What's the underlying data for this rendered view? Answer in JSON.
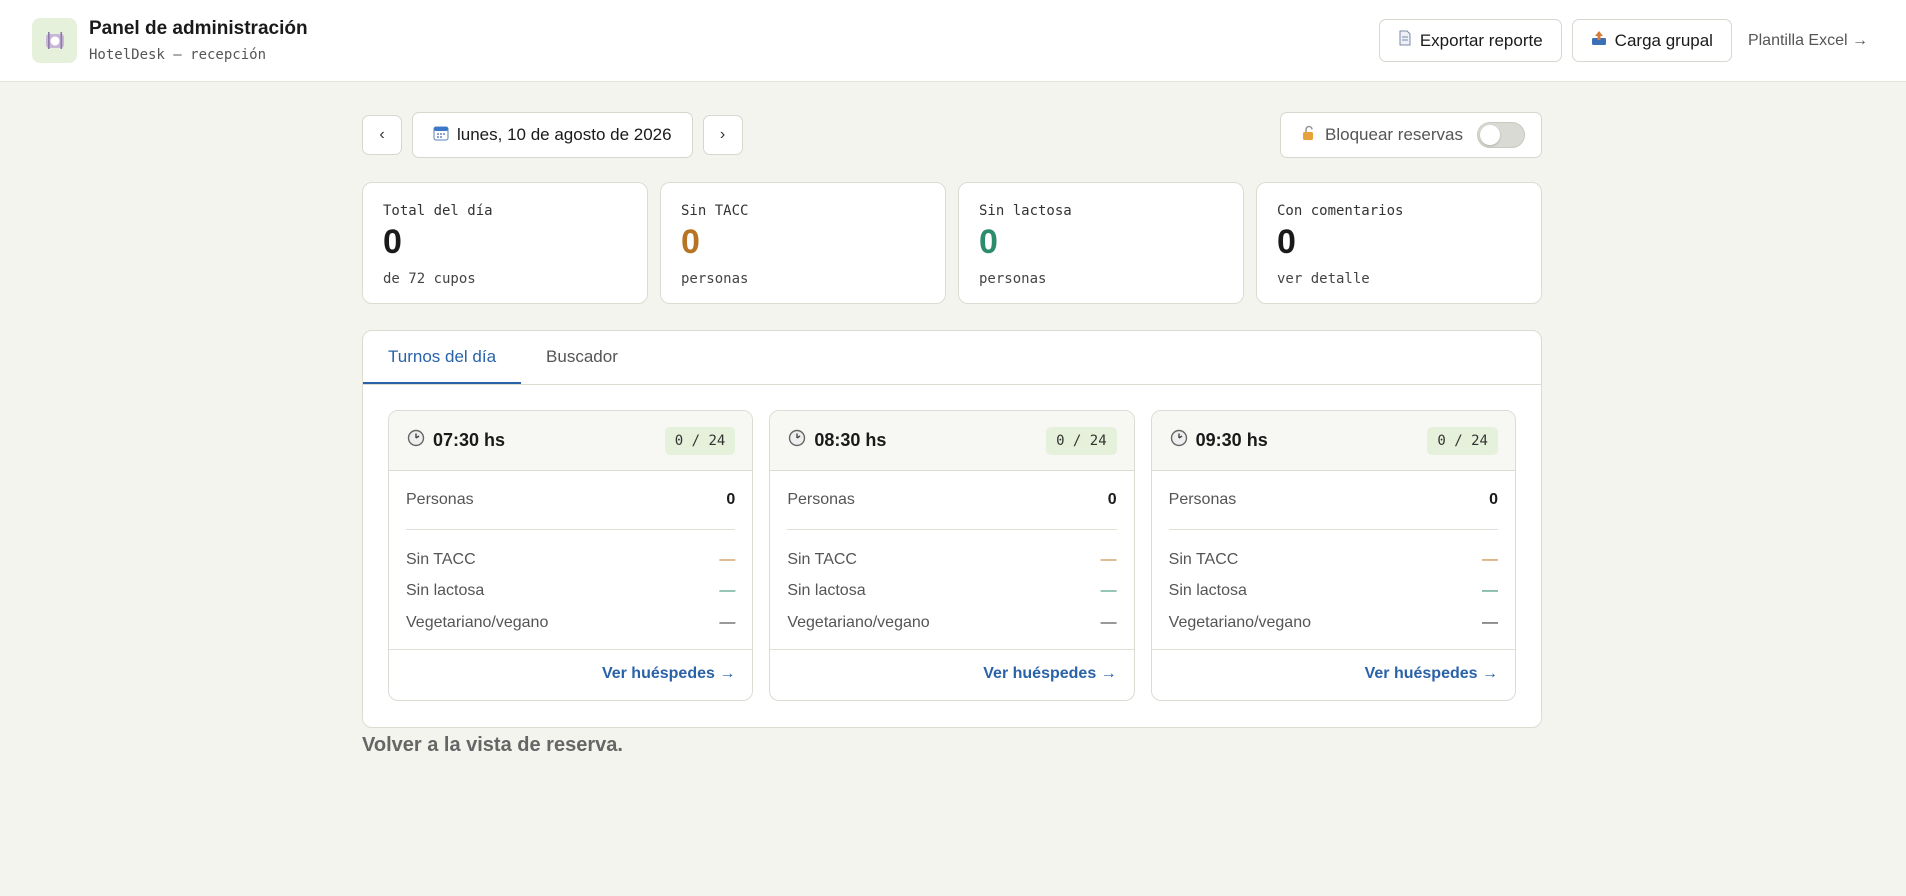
{
  "header": {
    "title": "Panel de administración",
    "subtitle": "HotelDesk — recepción",
    "logo_icon": "plate-cutlery-icon",
    "export_label": "Exportar reporte",
    "bulk_label": "Carga grupal",
    "template_link": "Plantilla Excel →"
  },
  "toolbar": {
    "prev": "‹",
    "next": "›",
    "date": "lunes, 10 de agosto de 2026",
    "lock_label": "Bloquear reservas",
    "lock_on": false
  },
  "stats": [
    {
      "label": "Total del día",
      "value": "0",
      "sub": "de 72 cupos",
      "color": "#1a1a1a"
    },
    {
      "label": "Sin TACC",
      "value": "0",
      "sub": "personas",
      "color": "#b87425"
    },
    {
      "label": "Sin lactosa",
      "value": "0",
      "sub": "personas",
      "color": "#2e8c6e"
    },
    {
      "label": "Con comentarios",
      "value": "0",
      "sub": "ver detalle",
      "color": "#1a1a1a"
    }
  ],
  "tabs": [
    {
      "label": "Turnos del día",
      "active": true
    },
    {
      "label": "Buscador",
      "active": false
    }
  ],
  "shifts": [
    {
      "time": "07:30 hs",
      "capacity": "0 / 24",
      "people_label": "Personas",
      "people": "0",
      "diets": [
        {
          "label": "Sin TACC",
          "value": "—",
          "color": "#c07b2c"
        },
        {
          "label": "Sin lactosa",
          "value": "—",
          "color": "#2e8c6e"
        },
        {
          "label": "Vegetariano/vegano",
          "value": "—",
          "color": "#333333"
        }
      ],
      "link": "Ver huéspedes →"
    },
    {
      "time": "08:30 hs",
      "capacity": "0 / 24",
      "people_label": "Personas",
      "people": "0",
      "diets": [
        {
          "label": "Sin TACC",
          "value": "—",
          "color": "#c07b2c"
        },
        {
          "label": "Sin lactosa",
          "value": "—",
          "color": "#2e8c6e"
        },
        {
          "label": "Vegetariano/vegano",
          "value": "—",
          "color": "#333333"
        }
      ],
      "link": "Ver huéspedes →"
    },
    {
      "time": "09:30 hs",
      "capacity": "0 / 24",
      "people_label": "Personas",
      "people": "0",
      "diets": [
        {
          "label": "Sin TACC",
          "value": "—",
          "color": "#c07b2c"
        },
        {
          "label": "Sin lactosa",
          "value": "—",
          "color": "#2e8c6e"
        },
        {
          "label": "Vegetariano/vegano",
          "value": "—",
          "color": "#333333"
        }
      ],
      "link": "Ver huéspedes →"
    }
  ],
  "back_link": "Volver a la vista de reserva."
}
